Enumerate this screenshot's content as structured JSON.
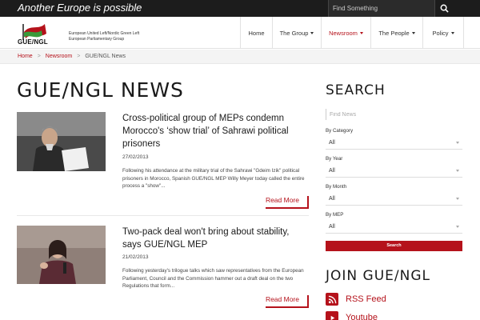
{
  "topbar": {
    "tagline": "Another Europe is possible",
    "search_placeholder": "Find Something"
  },
  "header": {
    "logo_text": "GUE/NGL",
    "org_line1": "European United Left/Nordic Green Left",
    "org_line2": "European Parliamentary Group",
    "nav": [
      {
        "label": "Home",
        "dropdown": false
      },
      {
        "label": "The Group",
        "dropdown": true
      },
      {
        "label": "Newsroom",
        "dropdown": true,
        "active": true
      },
      {
        "label": "The People",
        "dropdown": true
      },
      {
        "label": "Policy",
        "dropdown": true
      }
    ]
  },
  "breadcrumb": {
    "home": "Home",
    "newsroom": "Newsroom",
    "current": "GUE/NGL News"
  },
  "main": {
    "title": "GUE/NGL NEWS",
    "articles": [
      {
        "title": "Cross-political group of MEPs condemn Morocco's ‘show trial’ of Sahrawi political prisoners",
        "date": "27/02/2013",
        "excerpt": "Following his attendance at the military trial of the Sahrawi \"Gdeim Izik\" political prisoners in Morocco, Spanish GUE/NGL MEP Willy Meyer today called the entire process a \"show\"...",
        "read_more": "Read More"
      },
      {
        "title": "Two-pack deal won't bring about stability, says GUE/NGL MEP",
        "date": "21/02/2013",
        "excerpt": "Following yesterday's trilogue talks which saw representatives from the European Parliament, Council and the Commission hammer out a draft deal on the two Regulations that form...",
        "read_more": "Read More"
      }
    ]
  },
  "sidebar": {
    "search_heading": "SEARCH",
    "news_placeholder": "Find News",
    "filters": [
      {
        "label": "By Category",
        "value": "All"
      },
      {
        "label": "By Year",
        "value": "All"
      },
      {
        "label": "By Month",
        "value": "All"
      },
      {
        "label": "By MEP",
        "value": "All"
      }
    ],
    "search_button": "Search",
    "join_heading": "JOIN GUE/NGL",
    "social": [
      {
        "label": "RSS Feed",
        "icon": "rss-icon"
      },
      {
        "label": "Youtube",
        "icon": "youtube-icon"
      }
    ]
  },
  "colors": {
    "accent": "#b5121b",
    "topbar": "#1c1c1c"
  }
}
